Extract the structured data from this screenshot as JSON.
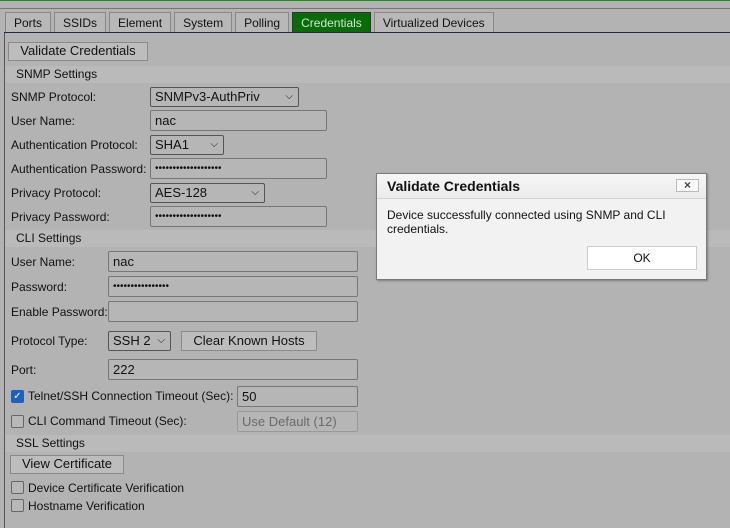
{
  "tabs": [
    {
      "label": "Ports",
      "active": false
    },
    {
      "label": "SSIDs",
      "active": false
    },
    {
      "label": "Element",
      "active": false
    },
    {
      "label": "System",
      "active": false
    },
    {
      "label": "Polling",
      "active": false
    },
    {
      "label": "Credentials",
      "active": true
    },
    {
      "label": "Virtualized Devices",
      "active": false
    }
  ],
  "toolbar": {
    "validate_label": "Validate Credentials"
  },
  "snmp": {
    "section_title": "SNMP Settings",
    "protocol_label": "SNMP Protocol:",
    "protocol_value": "SNMPv3-AuthPriv",
    "username_label": "User Name:",
    "username_value": "nac",
    "auth_protocol_label": "Authentication Protocol:",
    "auth_protocol_value": "SHA1",
    "auth_password_label": "Authentication Password:",
    "auth_password_value": "•••••••••••••••••••",
    "privacy_protocol_label": "Privacy Protocol:",
    "privacy_protocol_value": "AES-128",
    "privacy_password_label": "Privacy Password:",
    "privacy_password_value": "•••••••••••••••••••"
  },
  "cli": {
    "section_title": "CLI Settings",
    "username_label": "User Name:",
    "username_value": "nac",
    "password_label": "Password:",
    "password_value": "••••••••••••••••",
    "enable_password_label": "Enable Password:",
    "enable_password_value": "",
    "protocol_type_label": "Protocol Type:",
    "protocol_type_value": "SSH 2",
    "clear_known_hosts_label": "Clear Known Hosts",
    "port_label": "Port:",
    "port_value": "222",
    "conn_timeout_label": "Telnet/SSH Connection Timeout (Sec):",
    "conn_timeout_checked": true,
    "conn_timeout_value": "50",
    "cmd_timeout_label": "CLI Command Timeout (Sec):",
    "cmd_timeout_checked": false,
    "cmd_timeout_value": "Use Default (12)"
  },
  "ssl": {
    "section_title": "SSL Settings",
    "view_certificate_label": "View Certificate",
    "device_cert_label": "Device Certificate Verification",
    "device_cert_checked": false,
    "hostname_label": "Hostname Verification",
    "hostname_checked": false
  },
  "dialog": {
    "title": "Validate Credentials",
    "close_icon": "×",
    "message": "Device successfully connected using SNMP and CLI credentials.",
    "ok_label": "OK"
  },
  "icons": {
    "chevron": "❯",
    "check": "✓"
  }
}
